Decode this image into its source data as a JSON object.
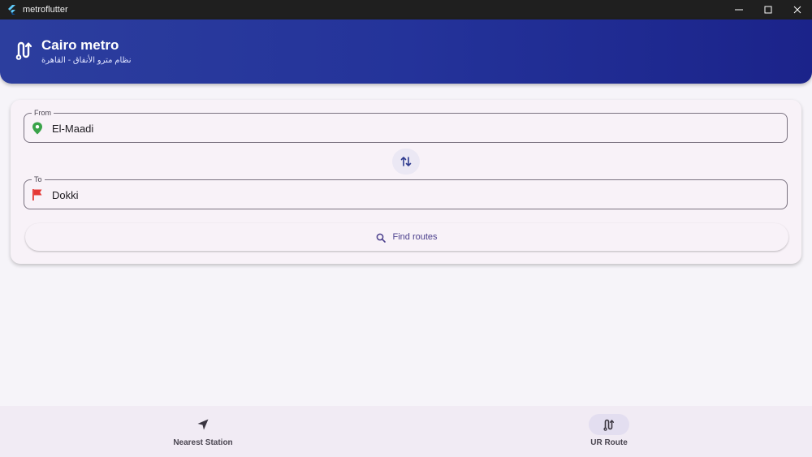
{
  "window": {
    "title": "metroflutter",
    "controls": {
      "minimize_icon": "minimize-icon",
      "maximize_icon": "maximize-icon",
      "close_icon": "close-icon"
    }
  },
  "header": {
    "title": "Cairo metro",
    "subtitle": "نظام مترو الأنفاق - القاهرة",
    "logo_icon": "route-icon",
    "gradient_start": "#2c3e9e",
    "gradient_end": "#1b238a"
  },
  "form": {
    "from": {
      "label": "From",
      "value": "El-Maadi",
      "icon": "location-pin-icon",
      "icon_color": "#3aa34a"
    },
    "to": {
      "label": "To",
      "value": "Dokki",
      "icon": "flag-icon",
      "icon_color": "#e53935"
    },
    "swap_icon": "swap-vertical-icon",
    "find_button": {
      "label": "Find routes",
      "icon": "search-icon"
    }
  },
  "bottom_nav": {
    "items": [
      {
        "label": "Nearest Station",
        "icon": "navigation-arrow-icon",
        "selected": false
      },
      {
        "label": "UR Route",
        "icon": "route-icon",
        "selected": true
      }
    ]
  }
}
